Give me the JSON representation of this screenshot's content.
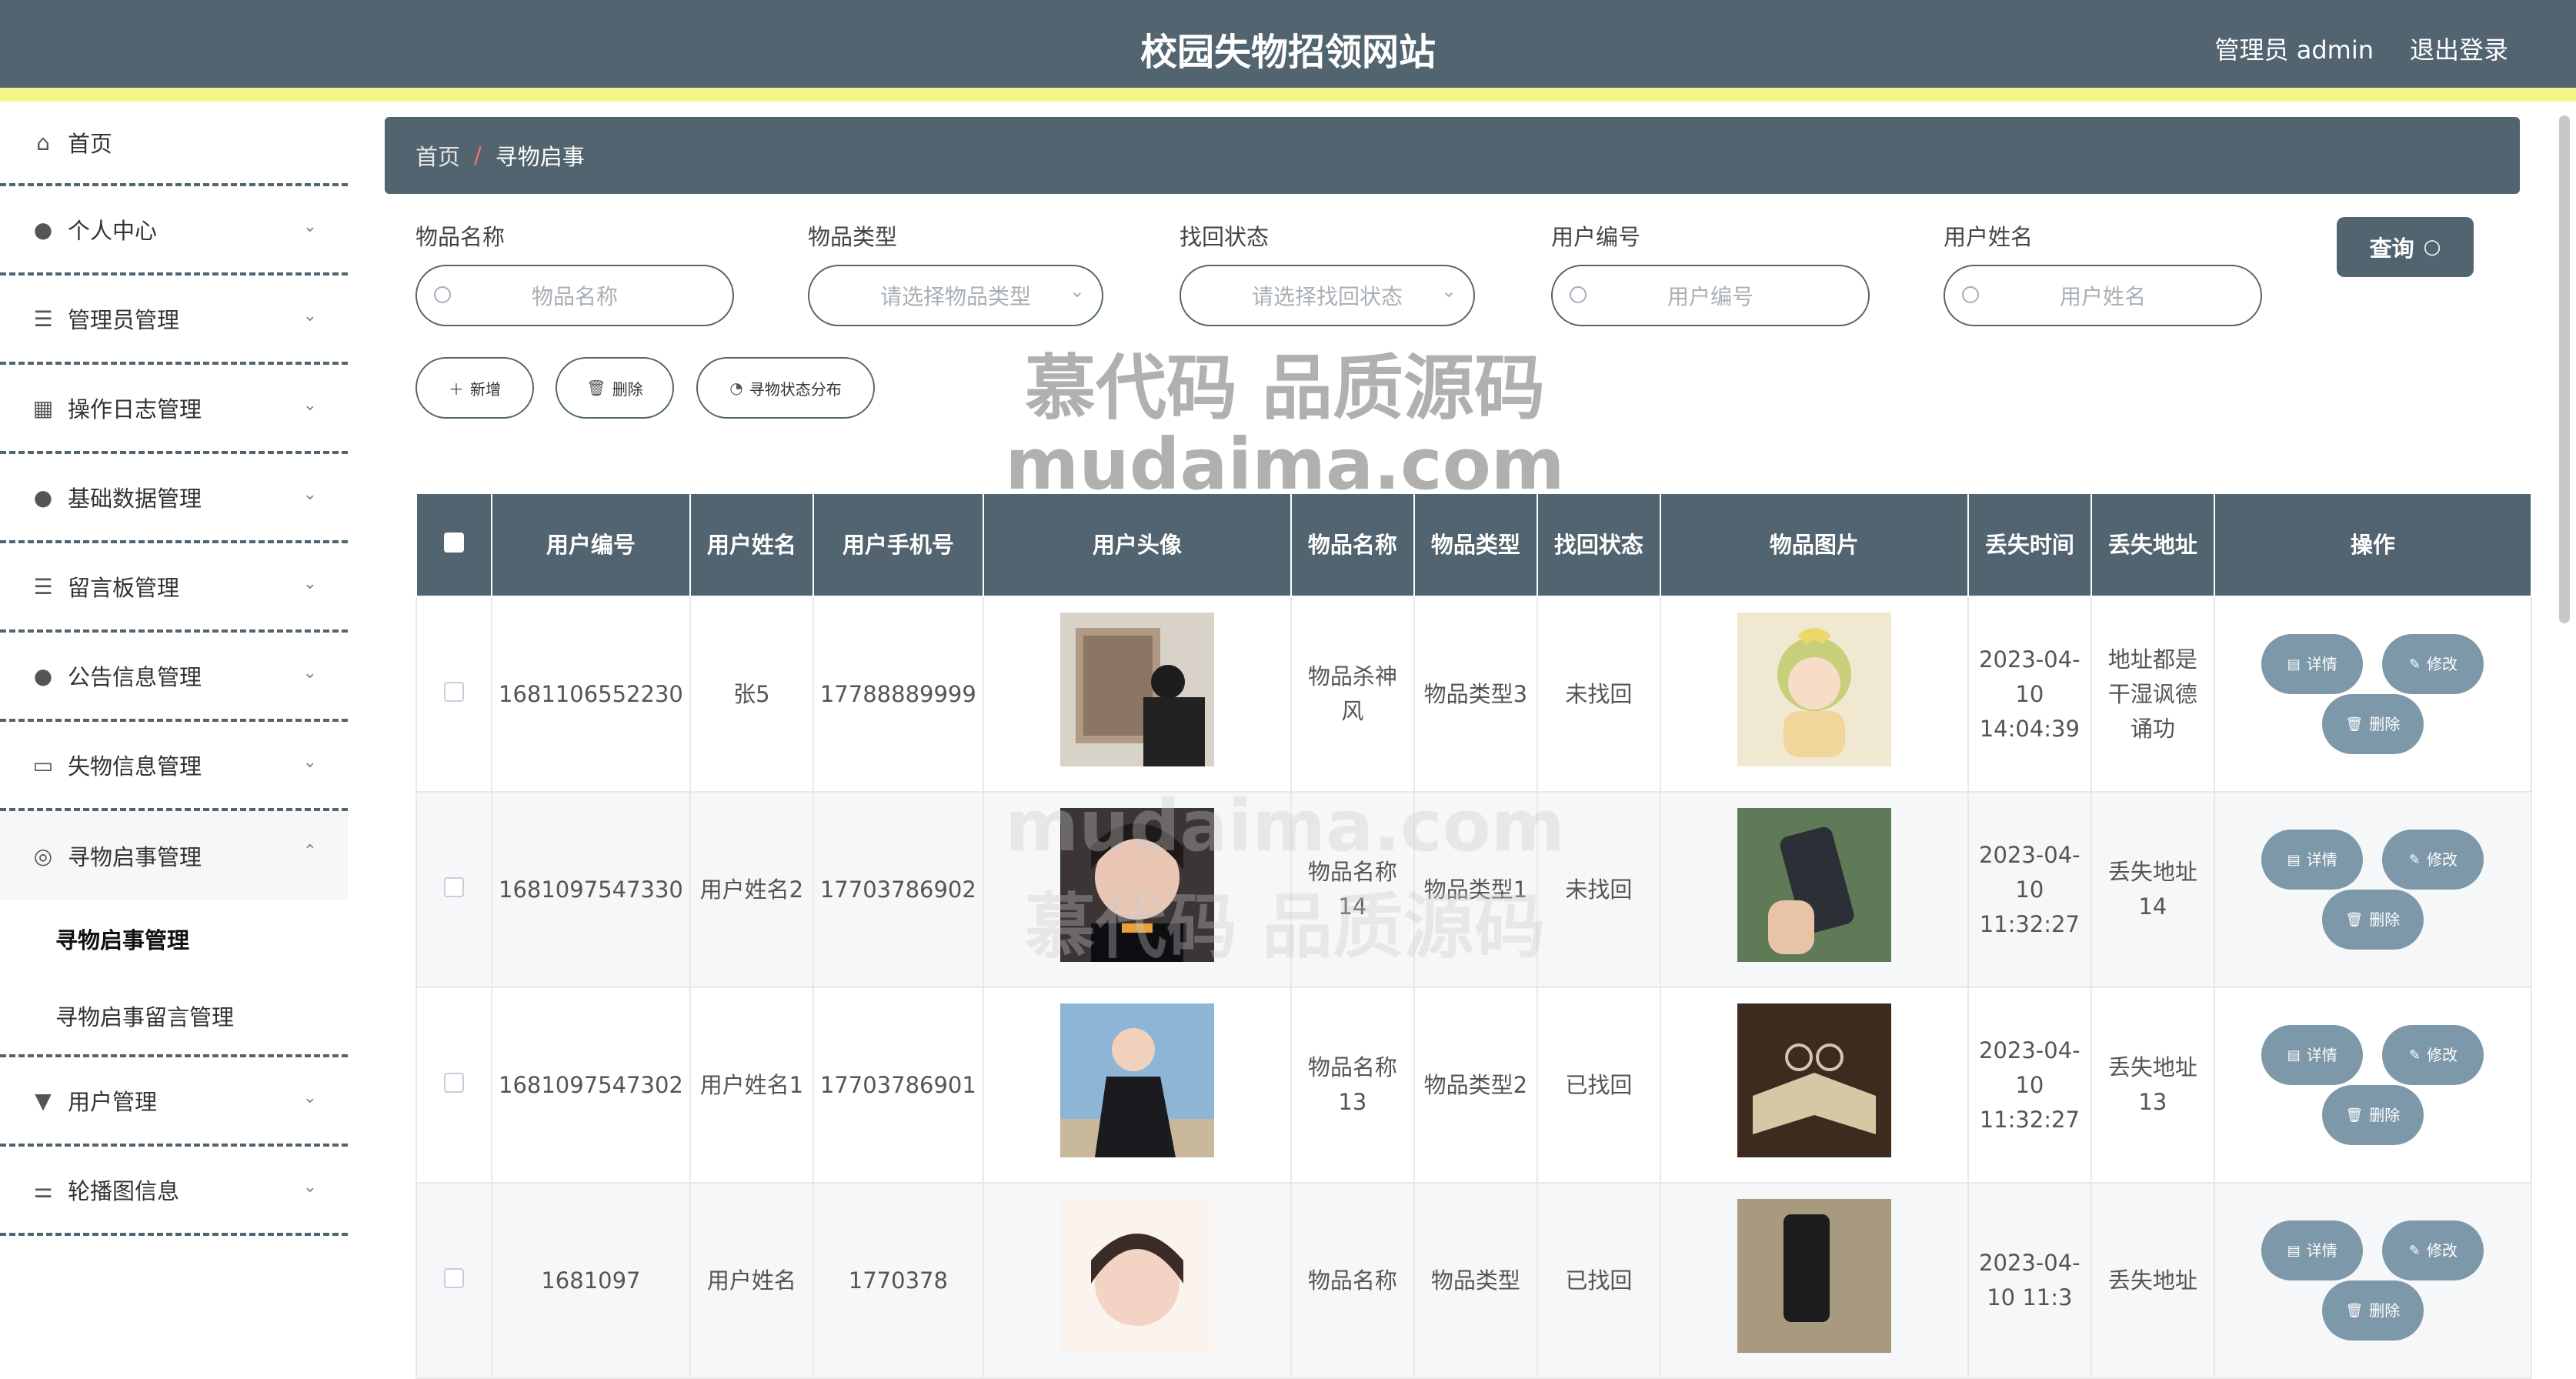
{
  "header": {
    "title": "校园失物招领网站",
    "admin": "管理员 admin",
    "logout": "退出登录"
  },
  "sidebar": {
    "items": [
      {
        "label": "首页",
        "icon": "home-icon"
      },
      {
        "label": "个人中心",
        "icon": "user-icon"
      },
      {
        "label": "管理员管理",
        "icon": "list-icon"
      },
      {
        "label": "操作日志管理",
        "icon": "grid-icon"
      },
      {
        "label": "基础数据管理",
        "icon": "user-icon"
      },
      {
        "label": "留言板管理",
        "icon": "list-icon"
      },
      {
        "label": "公告信息管理",
        "icon": "user-icon"
      },
      {
        "label": "失物信息管理",
        "icon": "card-icon"
      },
      {
        "label": "寻物启事管理",
        "icon": "target-icon"
      },
      {
        "label": "用户管理",
        "icon": "stamp-icon"
      },
      {
        "label": "轮播图信息",
        "icon": "sliders-icon"
      }
    ],
    "submenu": [
      "寻物启事管理",
      "寻物启事留言管理"
    ]
  },
  "breadcrumb": {
    "home": "首页",
    "sep": "/",
    "current": "寻物启事"
  },
  "filters": [
    {
      "label": "物品名称",
      "placeholder": "物品名称"
    },
    {
      "label": "物品类型",
      "placeholder": "请选择物品类型"
    },
    {
      "label": "找回状态",
      "placeholder": "请选择找回状态"
    },
    {
      "label": "用户编号",
      "placeholder": "用户编号"
    },
    {
      "label": "用户姓名",
      "placeholder": "用户姓名"
    }
  ],
  "query_label": "查询",
  "actions": {
    "add": "新增",
    "delete": "删除",
    "distribution": "寻物状态分布"
  },
  "table": {
    "headers": [
      "用户编号",
      "用户姓名",
      "用户手机号",
      "用户头像",
      "物品名称",
      "物品类型",
      "找回状态",
      "物品图片",
      "丢失时间",
      "丢失地址",
      "操作"
    ],
    "rows": [
      {
        "uid": "1681106552230",
        "name": "张5",
        "phone": "17788889999",
        "item": "物品杀神风",
        "type": "物品类型3",
        "status": "未找回",
        "time": "2023-04-10 14:04:39",
        "addr": "地址都是干湿讽德诵功"
      },
      {
        "uid": "1681097547330",
        "name": "用户姓名2",
        "phone": "17703786902",
        "item": "物品名称14",
        "type": "物品类型1",
        "status": "未找回",
        "time": "2023-04-10 11:32:27",
        "addr": "丢失地址14"
      },
      {
        "uid": "1681097547302",
        "name": "用户姓名1",
        "phone": "17703786901",
        "item": "物品名称13",
        "type": "物品类型2",
        "status": "已找回",
        "time": "2023-04-10 11:32:27",
        "addr": "丢失地址13"
      },
      {
        "uid": "1681097",
        "name": "用户姓名",
        "phone": "1770378",
        "item": "物品名称",
        "type": "物品类型",
        "status": "已找回",
        "time": "2023-04-10 11:3",
        "addr": "丢失地址"
      }
    ],
    "ops": {
      "detail": "详情",
      "edit": "修改",
      "delete": "删除"
    }
  },
  "watermark": {
    "line1": "慕代码 品质源码",
    "line2": "mudaima.com"
  }
}
